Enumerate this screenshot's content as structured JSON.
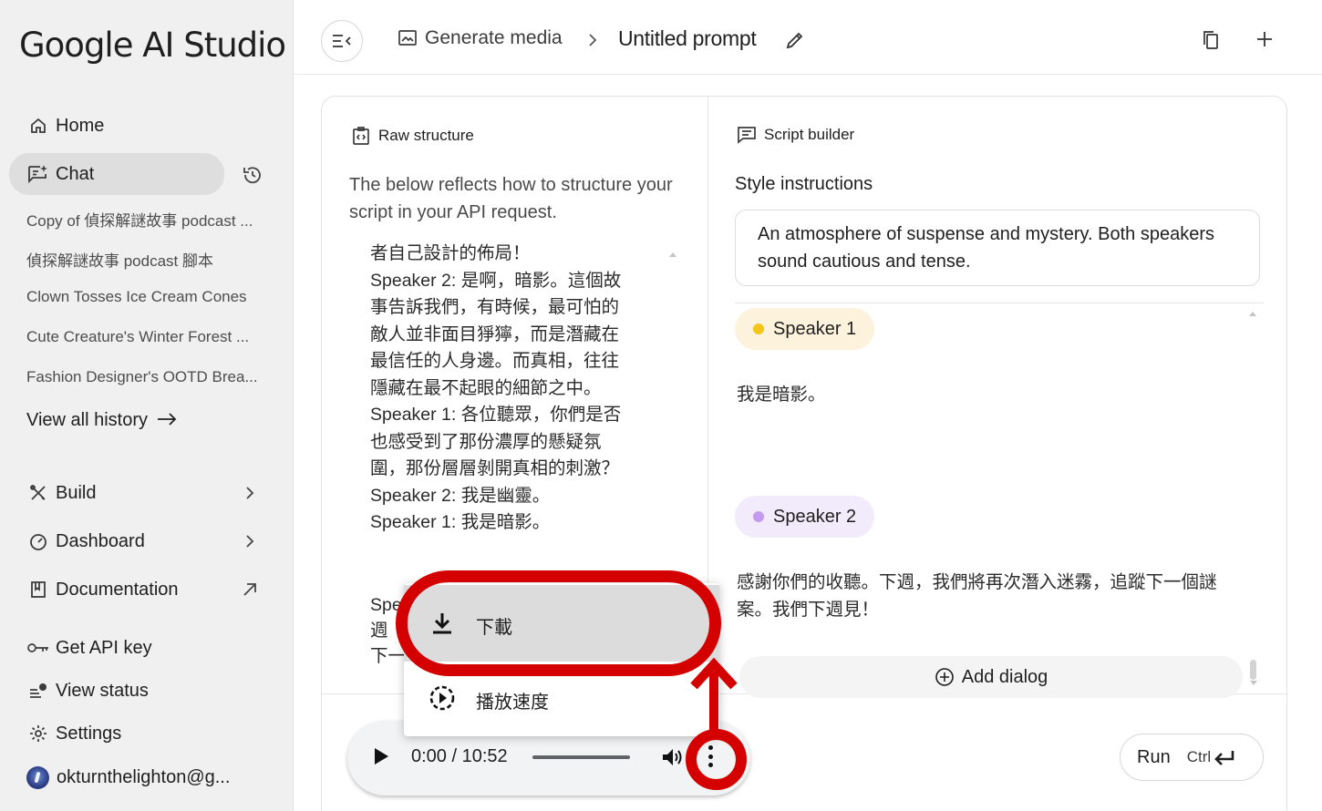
{
  "app": {
    "logo": "Google AI Studio"
  },
  "sidebar": {
    "home": "Home",
    "chat": "Chat",
    "history": [
      "Copy of 偵探解謎故事 podcast ...",
      "偵探解謎故事 podcast 腳本",
      "Clown Tosses Ice Cream Cones",
      "Cute Creature's Winter Forest ...",
      "Fashion Designer's OOTD Brea..."
    ],
    "view_all_history": "View all history",
    "build": "Build",
    "dashboard": "Dashboard",
    "documentation": "Documentation",
    "get_api_key": "Get API key",
    "view_status": "View status",
    "settings": "Settings",
    "account": "okturnthelighton@g..."
  },
  "topbar": {
    "breadcrumb": "Generate media",
    "title": "Untitled prompt"
  },
  "raw": {
    "heading": "Raw structure",
    "description": "The below reflects how to structure your script in your API request.",
    "script_lines": [
      "者自己設計的佈局！",
      "Speaker 2: 是啊，暗影。這個故",
      "事告訴我們，有時候，最可怕的",
      "敵人並非面目猙獰，而是潛藏在",
      "最信任的人身邊。而真相，往往",
      "隱藏在最不起眼的細節之中。",
      "Speaker 1: 各位聽眾，你們是否",
      "也感受到了那份濃厚的懸疑氛",
      "圍，那份層層剝開真相的刺激？",
      "Speaker 2: 我是幽靈。",
      "Speaker 1: 我是暗影。"
    ],
    "script_lines_2": [
      "Spe",
      "週",
      "下一"
    ]
  },
  "script": {
    "heading": "Script builder",
    "style_label": "Style instructions",
    "style_text": "An atmosphere of suspense and mystery. Both speakers sound cautious and tense.",
    "speaker1": {
      "name": "Speaker 1",
      "dot_color": "#f5c518",
      "chip_bg": "#fdf3dd",
      "line": "我是暗影。"
    },
    "speaker2": {
      "name": "Speaker 2",
      "dot_color": "#c39af0",
      "chip_bg": "#f2ebfb",
      "line": "感謝你們的收聽。下週，我們將再次潛入迷霧，追蹤下一個謎案。我們下週見！"
    },
    "add_dialog": "Add dialog"
  },
  "player": {
    "time": "0:00 / 10:52",
    "menu": {
      "download": "下載",
      "playback_speed": "播放速度"
    }
  },
  "run": {
    "label": "Run",
    "shortcut": "Ctrl"
  },
  "colors": {
    "annotation_red": "#d40000"
  }
}
